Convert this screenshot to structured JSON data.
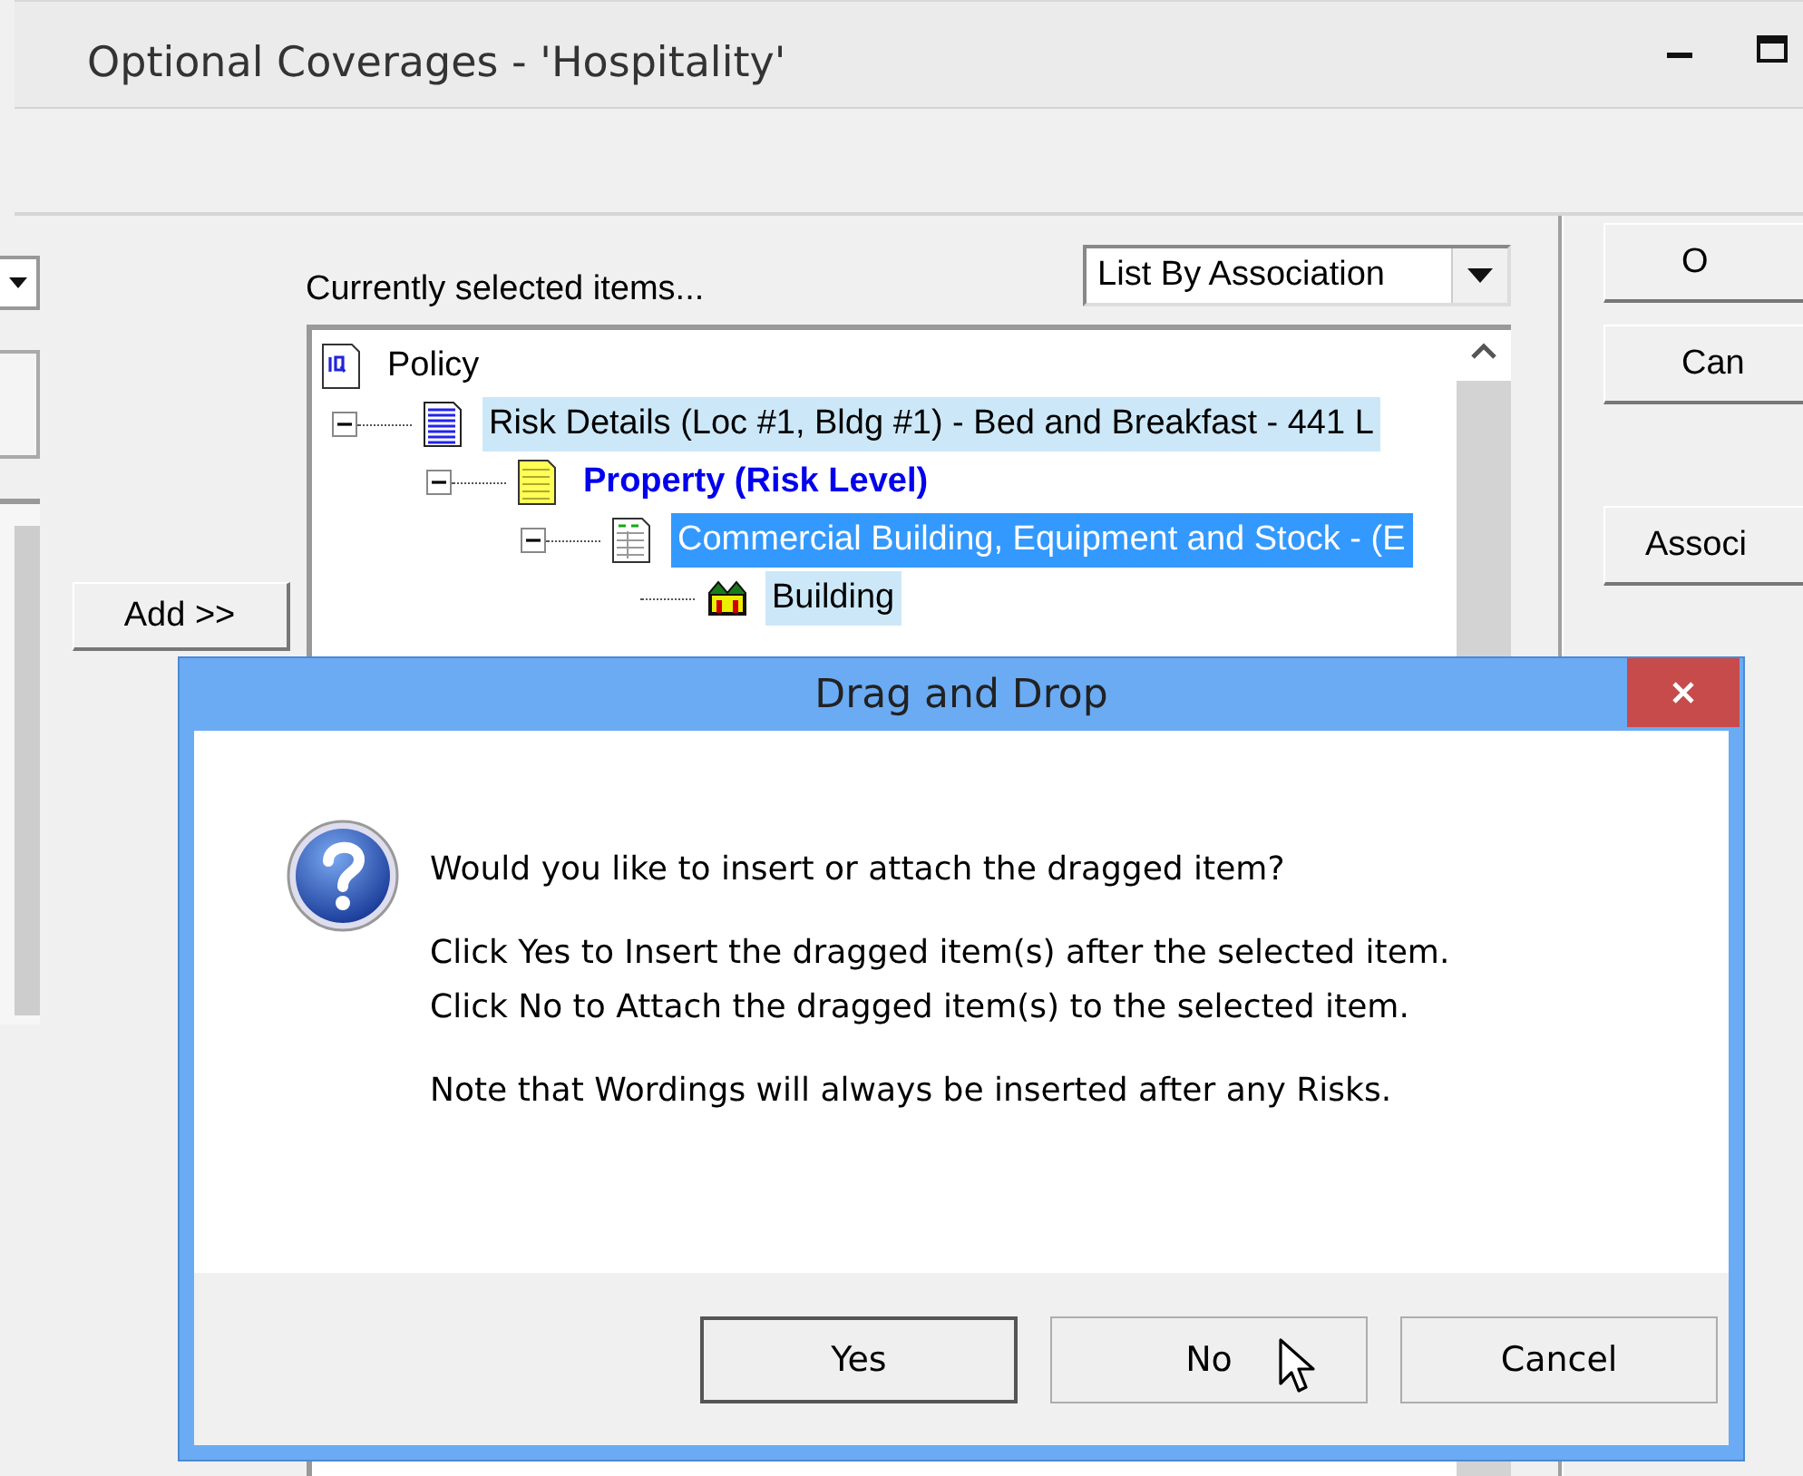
{
  "window": {
    "title": "Optional Coverages - 'Hospitality'"
  },
  "add_button": {
    "label": "Add >>"
  },
  "tree_label": "Currently selected items...",
  "view_select": {
    "value": "List By Association"
  },
  "tree": {
    "items": [
      {
        "label": "Policy",
        "kind": "policy",
        "selected": false,
        "highlighted": false,
        "bold": false,
        "children": [
          {
            "label": "Risk Details (Loc #1, Bldg #1) - Bed and Breakfast - 441 L",
            "kind": "risk",
            "selected": false,
            "highlighted": true,
            "bold": false,
            "expanded": true,
            "children": [
              {
                "label": "Property (Risk Level)",
                "kind": "section",
                "selected": false,
                "highlighted": false,
                "bold": true,
                "expanded": true,
                "children": [
                  {
                    "label": "Commercial Building, Equipment and Stock - (E",
                    "kind": "coverage",
                    "selected": true,
                    "bold": false,
                    "expanded": true,
                    "children": [
                      {
                        "label": "Building",
                        "kind": "building",
                        "selected": false,
                        "highlighted": true,
                        "bold": false
                      }
                    ]
                  }
                ]
              }
            ]
          }
        ]
      }
    ]
  },
  "side_buttons": [
    {
      "label": "O"
    },
    {
      "label": "Can"
    },
    {
      "label": "Associ"
    }
  ],
  "dialog": {
    "title": "Drag and Drop",
    "kind": "question",
    "paragraphs": [
      [
        "Would you like to insert or attach the dragged item?"
      ],
      [
        "Click Yes to Insert the dragged item(s) after the selected item.",
        "Click No to Attach the dragged item(s) to the selected item."
      ],
      [
        "Note that Wordings will always be inserted after any Risks."
      ]
    ],
    "buttons": [
      {
        "label": "Yes",
        "default": true
      },
      {
        "label": "No",
        "default": false
      },
      {
        "label": "Cancel",
        "default": false
      }
    ]
  }
}
